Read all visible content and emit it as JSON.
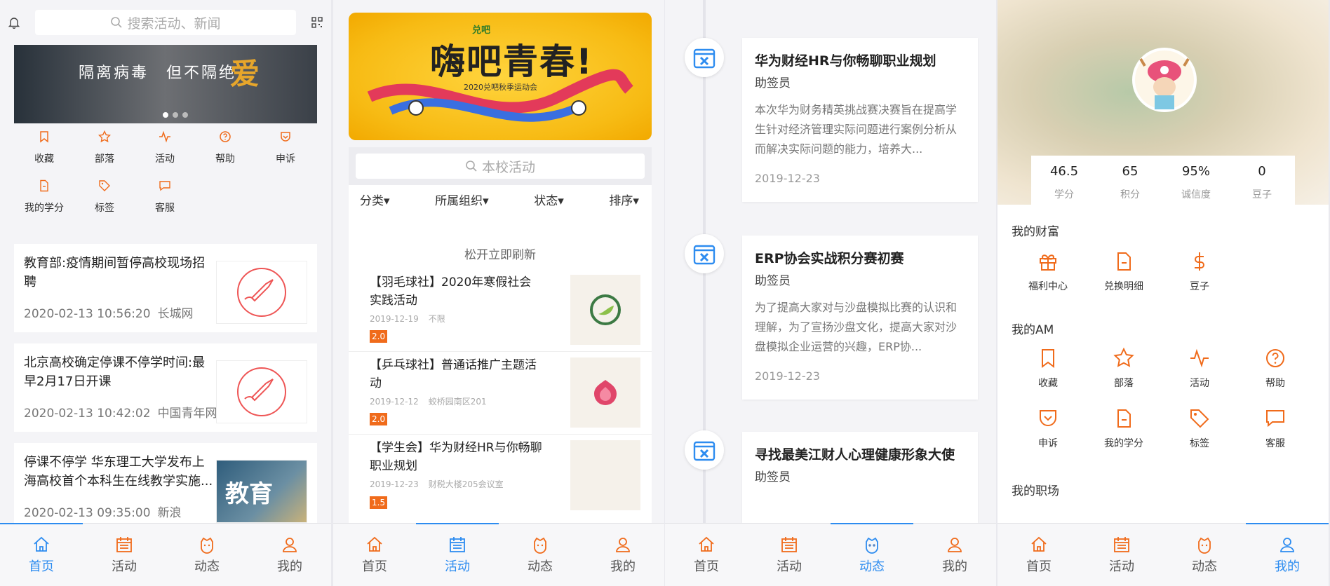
{
  "tabbar": {
    "home": "首页",
    "activity": "活动",
    "dynamic": "动态",
    "mine": "我的"
  },
  "screen1": {
    "search_placeholder": "搜索活动、新闻",
    "banner_text": "隔离病毒　但不隔绝",
    "banner_love": "爱",
    "grid": [
      {
        "label": "收藏",
        "icon": "bookmark-icon"
      },
      {
        "label": "部落",
        "icon": "star-icon"
      },
      {
        "label": "活动",
        "icon": "pulse-icon"
      },
      {
        "label": "帮助",
        "icon": "help-icon"
      },
      {
        "label": "申诉",
        "icon": "pocket-icon"
      },
      {
        "label": "我的学分",
        "icon": "document-icon"
      },
      {
        "label": "标签",
        "icon": "tag-icon"
      },
      {
        "label": "客服",
        "icon": "chat-icon"
      }
    ],
    "news": [
      {
        "title": "教育部:疫情期间暂停高校现场招聘",
        "time": "2020-02-13 10:56:20",
        "source": "长城网"
      },
      {
        "title": "北京高校确定停课不停学时间:最早2月17日开课",
        "time": "2020-02-13 10:42:02",
        "source": "中国青年网"
      },
      {
        "title": "停课不停学 华东理工大学发布上海高校首个本科生在线教学实施...",
        "time": "2020-02-13 09:35:00",
        "source": "新浪",
        "thumb_text": "教育"
      }
    ]
  },
  "screen2": {
    "banner_logo": "兑吧",
    "banner_title": "嗨吧青春!",
    "banner_sub": "2020兑吧秋季运动会",
    "search_placeholder": "本校活动",
    "filters": [
      "分类",
      "所属组织",
      "状态",
      "排序"
    ],
    "pull_text": "松开立即刷新",
    "activities": [
      {
        "title": "【羽毛球社】2020年寒假社会实践活动",
        "date": "2019-12-19",
        "place": "不限",
        "credit": "2.0"
      },
      {
        "title": "【乒乓球社】普通话推广主题活动",
        "date": "2019-12-12",
        "place": "蛟桥园南区201",
        "credit": "2.0"
      },
      {
        "title": "【学生会】华为财经HR与你畅聊职业规划",
        "date": "2019-12-23",
        "place": "财税大楼205会议室",
        "credit": "1.5"
      }
    ]
  },
  "screen3": {
    "posts": [
      {
        "title": "华为财经HR与你畅聊职业规划",
        "role": "助签员",
        "desc": "本次华为财务精英挑战赛决赛旨在提高学生针对经济管理实际问题进行案例分析从而解决实际问题的能力，培养大...",
        "date": "2019-12-23"
      },
      {
        "title": "ERP协会实战积分赛初赛",
        "role": "助签员",
        "desc": "为了提高大家对与沙盘模拟比赛的认识和理解，为了宣扬沙盘文化，提高大家对沙盘模拟企业运营的兴趣，ERP协...",
        "date": "2019-12-23"
      },
      {
        "title": "寻找最美江财人心理健康形象大使",
        "role": "助签员",
        "desc": "",
        "date": ""
      }
    ]
  },
  "screen4": {
    "stats": [
      {
        "value": "46.5",
        "label": "学分"
      },
      {
        "value": "65",
        "label": "积分"
      },
      {
        "value": "95%",
        "label": "诚信度"
      },
      {
        "value": "0",
        "label": "豆子"
      }
    ],
    "wealth_title": "我的财富",
    "wealth": [
      {
        "label": "福利中心",
        "icon": "gift-icon"
      },
      {
        "label": "兑换明细",
        "icon": "document-icon"
      },
      {
        "label": "豆子",
        "icon": "dollar-icon"
      }
    ],
    "am_title": "我的AM",
    "am": [
      {
        "label": "收藏",
        "icon": "bookmark-icon"
      },
      {
        "label": "部落",
        "icon": "star-icon"
      },
      {
        "label": "活动",
        "icon": "pulse-icon"
      },
      {
        "label": "帮助",
        "icon": "help-icon"
      },
      {
        "label": "申诉",
        "icon": "pocket-icon"
      },
      {
        "label": "我的学分",
        "icon": "document-icon"
      },
      {
        "label": "标签",
        "icon": "tag-icon"
      },
      {
        "label": "客服",
        "icon": "chat-icon"
      }
    ],
    "career_title": "我的职场"
  },
  "colors": {
    "accent": "#f06b1b",
    "active_tab": "#2d8cf0",
    "timeline_node": "#2d8cf0"
  }
}
